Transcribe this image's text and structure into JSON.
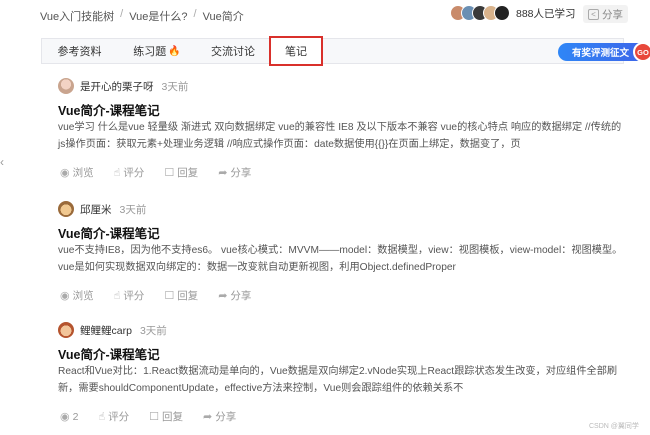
{
  "breadcrumbs": [
    "Vue入门技能树",
    "Vue是什么?",
    "Vue简介"
  ],
  "learners_text": "888人已学习",
  "share_label": "分享",
  "tabs": [
    {
      "label": "参考资料"
    },
    {
      "label": "练习题"
    },
    {
      "label": "交流讨论"
    },
    {
      "label": "笔记"
    }
  ],
  "eval_button": "有奖评测征文",
  "go_badge": "GO",
  "notes": [
    {
      "user": "是开心的栗子呀",
      "time": "3天前",
      "title": "Vue简介-课程笔记",
      "body": "vue学习 什么是vue 轻量级 渐进式 双向数据绑定 vue的兼容性 IE8 及以下版本不兼容 vue的核心特点 响应的数据绑定 //传统的js操作页面：获取元素+处理业务逻辑 //响应式操作页面：date数据使用{{}}在页面上绑定，数据变了，页",
      "actions": {
        "view": "浏览",
        "rate": "评分",
        "reply": "回复",
        "share": "分享"
      }
    },
    {
      "user": "邱厘米",
      "time": "3天前",
      "title": "Vue简介-课程笔记",
      "body": "vue不支持IE8，因为他不支持es6。 vue核心模式：MVVM——model：数据模型，view：视图模板，view-model：视图模型。vue是如何实现数据双向绑定的：数据一改变就自动更新视图，利用Object.definedProper",
      "actions": {
        "view": "浏览",
        "rate": "评分",
        "reply": "回复",
        "share": "分享"
      }
    },
    {
      "user": "鲤鲤鲤carp",
      "time": "3天前",
      "title": "Vue简介-课程笔记",
      "body": "React和Vue对比：1.React数据流动是单向的，Vue数据是双向绑定2.vNode实现上React跟踪状态发生改变，对应组件全部刷新，需要shouldComponentUpdate，effective方法来控制，Vue则会跟踪组件的依赖关系不",
      "actions": {
        "view": "2",
        "rate": "评分",
        "reply": "回复",
        "share": "分享"
      }
    }
  ],
  "watermark": "CSDN @翼同学",
  "colors": {
    "active_tab_border": "#d9302b",
    "eval_button": "#2f86f6",
    "go_badge": "#e8483b"
  }
}
